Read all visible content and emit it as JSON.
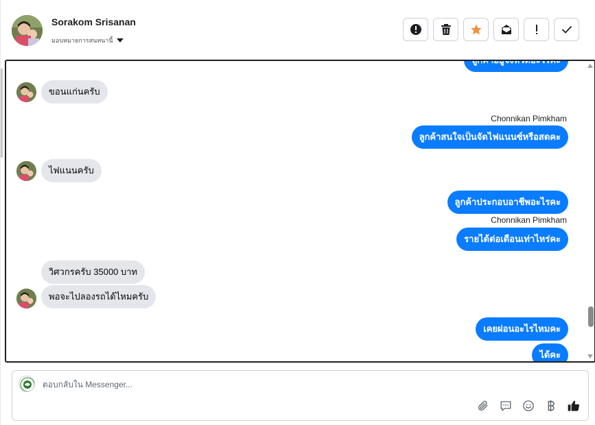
{
  "header": {
    "contact_name": "Sorakom Srisanan",
    "assign_label": "มอบหมายการสนทนานี้",
    "toolbar": [
      {
        "name": "report-button",
        "icon": "exclamation-circle-icon"
      },
      {
        "name": "delete-button",
        "icon": "trash-icon"
      },
      {
        "name": "star-button",
        "icon": "star-icon",
        "color": "#f5903d"
      },
      {
        "name": "mark-unread-button",
        "icon": "envelope-open-icon"
      },
      {
        "name": "spam-button",
        "icon": "exclamation-icon"
      },
      {
        "name": "mark-done-button",
        "icon": "check-icon"
      }
    ]
  },
  "messages": [
    {
      "dir": "out",
      "text": "ลูกค้าอยู่จังหวัดอะไรคะ"
    },
    {
      "dir": "in",
      "text": "ขอนแก่นครับ"
    },
    {
      "dir": "out",
      "sender": "Chonnikan Pimkham",
      "text": "ลูกค้าสนใจเป็นจัดไฟแนนซ์หรือสดคะ"
    },
    {
      "dir": "in",
      "text": "ไฟแนนครับ"
    },
    {
      "dir": "out",
      "text": "ลูกค้าประกอบอาชีพอะไรคะ"
    },
    {
      "dir": "out",
      "sender": "Chonnikan Pimkham",
      "text": "รายได้ต่อเดือนเท่าไหร่คะ"
    },
    {
      "dir": "in",
      "text": "วิศวกรครับ 35000 บาท"
    },
    {
      "dir": "in",
      "text": "พอจะไปลองรถได้ไหมครับ"
    },
    {
      "dir": "out",
      "text": "เคยผ่อนอะไรไหมคะ"
    },
    {
      "dir": "out",
      "text": "ได้คะ"
    }
  ],
  "composer": {
    "placeholder": "ตอบกลับใน Messenger...",
    "icons": [
      "paperclip-icon",
      "chat-bubble-icon",
      "emoji-icon",
      "baht-icon",
      "thumbs-up-icon"
    ]
  },
  "colors": {
    "outgoing_bubble": "#0a7cff",
    "incoming_bubble": "#e4e6eb",
    "star": "#f5903d"
  }
}
